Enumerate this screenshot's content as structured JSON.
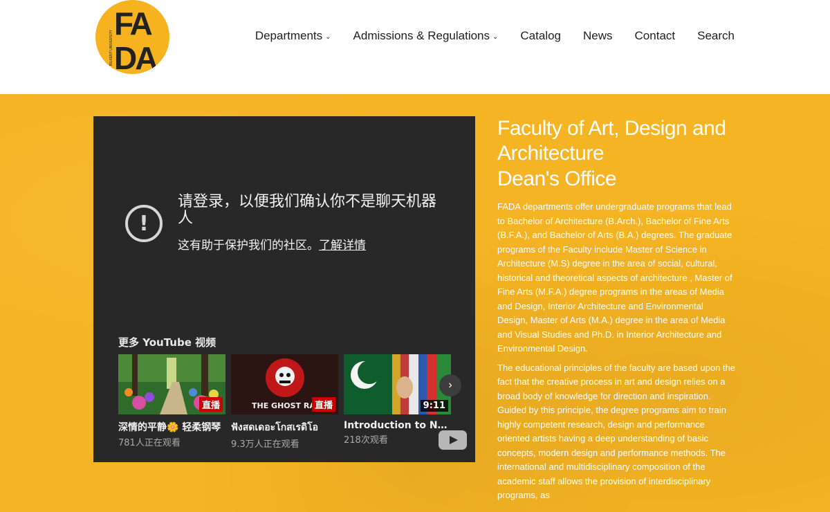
{
  "logo": {
    "text": "FADA",
    "side_text": "BILKENT UNIVERSITY"
  },
  "nav": [
    {
      "label": "Departments",
      "dropdown": true
    },
    {
      "label": "Admissions & Regulations",
      "dropdown": true
    },
    {
      "label": "Catalog",
      "dropdown": false
    },
    {
      "label": "News",
      "dropdown": false
    },
    {
      "label": "Contact",
      "dropdown": false
    },
    {
      "label": "Search",
      "dropdown": false
    }
  ],
  "video": {
    "alert_title": "请登录，以便我们确认你不是聊天机器人",
    "alert_sub": "这有助于保护我们的社区。",
    "alert_link": "了解详情",
    "more_title": "更多 YouTube 视频",
    "thumbs": [
      {
        "title": "深情的平静🌼 轻柔钢琴",
        "meta": "781人正在观看",
        "badge": "直播",
        "badge_type": "live"
      },
      {
        "title": "ฟังสดเดอะโกสเรดิโอ",
        "meta": "9.3万人正在观看",
        "badge": "直播",
        "badge_type": "live"
      },
      {
        "title": "Introduction to North",
        "meta": "218次观看",
        "badge": "9:11",
        "badge_type": "time"
      }
    ]
  },
  "content": {
    "title": "Faculty of Art, Design and Architecture",
    "subtitle": "Dean's Office",
    "para1": "FADA departments offer undergraduate programs that lead to Bachelor of Architecture (B.Arch.), Bachelor of Fine Arts (B.F.A.), and Bachelor of Arts (B.A.) degrees. The graduate programs of the Faculty include Master of Science in Architecture (M.S) degree in the area of social, cultural, historical and theoretical aspects of architecture , Master of Fine Arts (M.F.A.) degree programs in the areas of Media and Design, Interior Architecture and Environmental Design, Master of Arts (M.A.) degree in the area of Media and Visual Studies and Ph.D. in Interior Architecture and Environmental Design.",
    "para2": "The educational principles of the faculty are based upon the fact that the creative process in art and design relies on a broad body of knowledge for direction and inspiration. Guided by this principle, the degree programs aim to train highly competent research, design and performance oriented artists having a deep understanding of basic concepts, modern design and performance methods. The international and multidisciplinary composition of the academic staff allows the provision of interdisciplinary programs, as"
  },
  "colors": {
    "brand_yellow": "#f5b423",
    "video_bg": "#282828",
    "live_red": "#cc0000"
  }
}
